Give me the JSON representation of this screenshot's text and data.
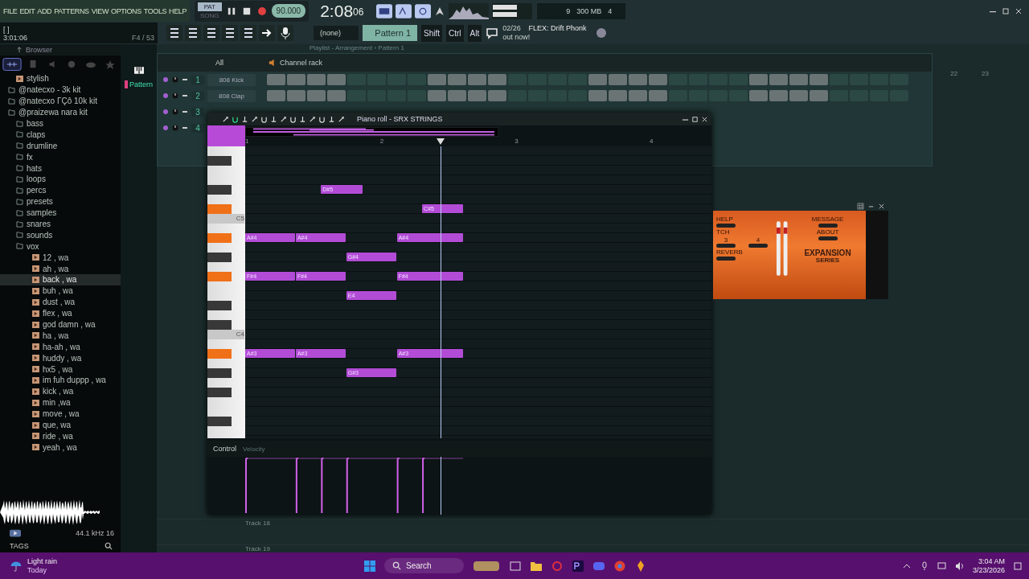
{
  "menu": [
    "FILE",
    "EDIT",
    "ADD",
    "PATTERNS",
    "VIEW",
    "OPTIONS",
    "TOOLS",
    "HELP"
  ],
  "transport": {
    "modes": [
      {
        "label": "PAT",
        "selected": true
      },
      {
        "label": "SONG",
        "selected": false
      }
    ],
    "tempo": "90.000",
    "time_main": "2:08",
    "time_sub": "06",
    "cpu": "9",
    "memory": "300 MB",
    "polyphony": "4"
  },
  "hint_bar": {
    "bracket": "[ ]",
    "time": "3:01:06",
    "key": "F4 / 53"
  },
  "toolbar": {
    "preset": "(none)",
    "pattern": "Pattern 1",
    "modifier_keys": [
      "Shift",
      "Ctrl",
      "Alt"
    ],
    "news": {
      "date": "02/26",
      "headline": "FLEX: Drift Phonk",
      "subline": "out now!"
    }
  },
  "browser": {
    "title": "Browser",
    "tree": [
      {
        "label": "stylish",
        "kind": "file",
        "selected": false
      },
      {
        "label": "@natecxo - 3k kit",
        "kind": "folder",
        "selected": false
      },
      {
        "label": "@natecxo ΓÇô 10k kit",
        "kind": "folder",
        "selected": false
      },
      {
        "label": "@praizewa nara kit",
        "kind": "folder",
        "selected": false,
        "children": [
          {
            "label": "bass",
            "kind": "folder",
            "selected": false
          },
          {
            "label": "claps",
            "kind": "folder",
            "selected": false
          },
          {
            "label": "drumline",
            "kind": "folder",
            "selected": false
          },
          {
            "label": "fx",
            "kind": "folder",
            "selected": false
          },
          {
            "label": "hats",
            "kind": "folder",
            "selected": false
          },
          {
            "label": "loops",
            "kind": "folder",
            "selected": false
          },
          {
            "label": "percs",
            "kind": "folder",
            "selected": false
          },
          {
            "label": "presets",
            "kind": "folder",
            "selected": false
          },
          {
            "label": "samples",
            "kind": "folder",
            "selected": false
          },
          {
            "label": "snares",
            "kind": "folder",
            "selected": false
          },
          {
            "label": "sounds",
            "kind": "folder",
            "selected": false
          },
          {
            "label": "vox",
            "kind": "folder",
            "selected": false,
            "children": [
              {
                "label": "12 , wa",
                "kind": "file",
                "selected": false
              },
              {
                "label": "ah , wa",
                "kind": "file",
                "selected": false
              },
              {
                "label": "back , wa",
                "kind": "file",
                "selected": true
              },
              {
                "label": "buh , wa",
                "kind": "file",
                "selected": false
              },
              {
                "label": "dust , wa",
                "kind": "file",
                "selected": false
              },
              {
                "label": "flex , wa",
                "kind": "file",
                "selected": false
              },
              {
                "label": "god damn , wa",
                "kind": "file",
                "selected": false
              },
              {
                "label": "ha , wa",
                "kind": "file",
                "selected": false
              },
              {
                "label": "ha-ah , wa",
                "kind": "file",
                "selected": false
              },
              {
                "label": "huddy , wa",
                "kind": "file",
                "selected": false
              },
              {
                "label": "hx5 , wa",
                "kind": "file",
                "selected": false
              },
              {
                "label": "im fuh duppp , wa",
                "kind": "file",
                "selected": false
              },
              {
                "label": "kick , wa",
                "kind": "file",
                "selected": false
              },
              {
                "label": "min ,wa",
                "kind": "file",
                "selected": false
              },
              {
                "label": "move , wa",
                "kind": "file",
                "selected": false
              },
              {
                "label": "que, wa",
                "kind": "file",
                "selected": false
              },
              {
                "label": "ride , wa",
                "kind": "file",
                "selected": false
              },
              {
                "label": "yeah , wa",
                "kind": "file",
                "selected": false
              }
            ]
          }
        ]
      }
    ],
    "sample_info": "44.1 kHz 16",
    "tags_label": "TAGS"
  },
  "picker": {
    "item": "Pattern"
  },
  "playlist": {
    "title": "Playlist - Arrangement › Pattern 1",
    "ruler": [
      "22",
      "23"
    ],
    "tracks": [
      "Track 18",
      "Track 19"
    ]
  },
  "channel_rack": {
    "title": "Channel rack",
    "filter": "All",
    "channels": [
      {
        "number": "1",
        "name": "808 Kick"
      },
      {
        "number": "2",
        "name": "808 Clap"
      },
      {
        "number": "3"
      },
      {
        "number": "4"
      }
    ]
  },
  "piano_roll": {
    "title": "Piano roll - SRX STRINGS",
    "ruler": [
      "1",
      "2",
      "3",
      "4"
    ],
    "octave_labels": [
      "C5",
      "C4"
    ],
    "black_keys": [
      {
        "highlighted": false
      },
      {
        "highlighted": false
      },
      {
        "highlighted": true
      },
      {
        "highlighted": true
      },
      {
        "highlighted": false
      },
      {
        "highlighted": true
      },
      {
        "highlighted": false
      },
      {
        "highlighted": false
      },
      {
        "highlighted": true
      },
      {
        "highlighted": false
      },
      {
        "highlighted": false
      },
      {
        "highlighted": false
      }
    ],
    "notes": [
      {
        "label": "D#5"
      },
      {
        "label": "C#5"
      },
      {
        "label": "A#4"
      },
      {
        "label": "A#4"
      },
      {
        "label": "A#4"
      },
      {
        "label": "G#4"
      },
      {
        "label": "F#4"
      },
      {
        "label": "F#4"
      },
      {
        "label": "F#4"
      },
      {
        "label": "E4"
      },
      {
        "label": "A#3"
      },
      {
        "label": "A#3"
      },
      {
        "label": "A#3"
      },
      {
        "label": "G#3"
      }
    ],
    "control_label": "Control",
    "control_target": "Velocity"
  },
  "plugin": {
    "help": "HELP",
    "pitch": "TCH",
    "pitch_options": [
      "3",
      "4"
    ],
    "reverb": "REVERB",
    "message": "MESSAGE",
    "about": "ABOUT",
    "brand": "EXPANSION",
    "brand_sub": "SERIES"
  },
  "taskbar": {
    "weather": "Light rain",
    "weather_day": "Today",
    "search": "Search",
    "time": "3:04 AM",
    "date": "3/23/2026"
  }
}
